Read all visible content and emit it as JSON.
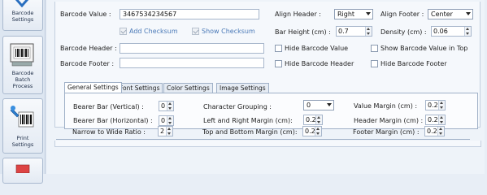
{
  "sidebar": {
    "items": [
      {
        "label": "Barcode\nSettings"
      },
      {
        "label": "Barcode\nBatch\nProcess"
      },
      {
        "label": "Print\nSettings"
      }
    ]
  },
  "form": {
    "barcode_value_label": "Barcode Value :",
    "barcode_value": "3467534234567",
    "add_checksum_label": "Add Checksum",
    "show_checksum_label": "Show Checksum",
    "barcode_header_label": "Barcode Header :",
    "barcode_header_value": "",
    "barcode_footer_label": "Barcode Footer :",
    "barcode_footer_value": "",
    "align_header_label": "Align Header :",
    "align_header_value": "Right",
    "align_footer_label": "Align Footer :",
    "align_footer_value": "Center",
    "bar_height_label": "Bar Height (cm) :",
    "bar_height_value": "0.7",
    "density_label": "Density (cm) :",
    "density_value": "0.06",
    "hide_barcode_value_label": "Hide Barcode Value",
    "show_barcode_value_top_label": "Show Barcode Value in Top",
    "hide_barcode_header_label": "Hide Barcode Header",
    "hide_barcode_footer_label": "Hide Barcode Footer"
  },
  "tabs": [
    {
      "label": "General Settings"
    },
    {
      "label": "Font Settings"
    },
    {
      "label": "Color Settings"
    },
    {
      "label": "Image Settings"
    }
  ],
  "general": {
    "bearer_v_label": "Bearer Bar (Vertical) :",
    "bearer_v_value": "0",
    "bearer_h_label": "Bearer Bar (Horizontal) :",
    "bearer_h_value": "0",
    "ratio_label": "Narrow to Wide Ratio :",
    "ratio_value": "2",
    "char_group_label": "Character Grouping :",
    "char_group_value": "0",
    "lr_margin_label": "Left and Right Margin (cm):",
    "lr_margin_value": "0.20",
    "tb_margin_label": "Top and Bottom Margin (cm):",
    "tb_margin_value": "0.20",
    "value_margin_label": "Value Margin (cm) :",
    "value_margin_value": "0.20",
    "header_margin_label": "Header Margin (cm) :",
    "header_margin_value": "0.20",
    "footer_margin_label": "Footer Margin (cm) :",
    "footer_margin_value": "0.20"
  }
}
